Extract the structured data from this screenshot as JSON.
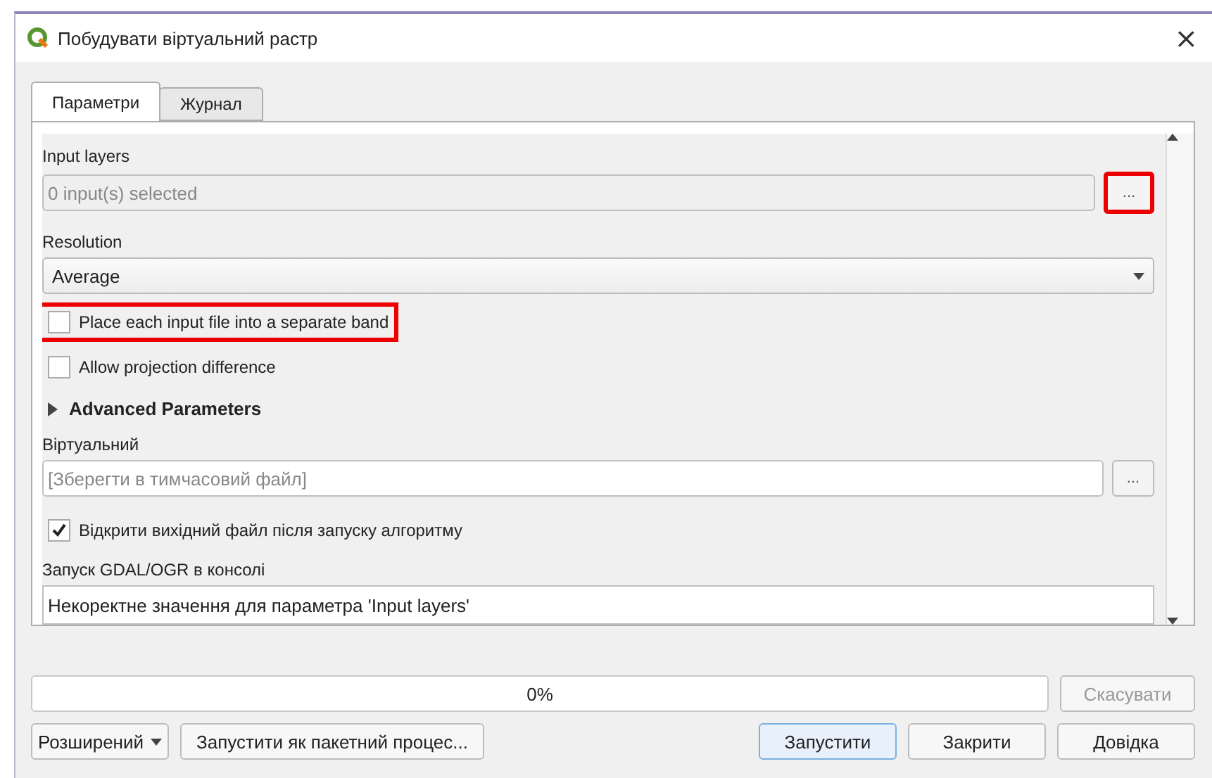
{
  "window": {
    "title": "Побудувати віртуальний растр",
    "close": "×"
  },
  "tabs": [
    {
      "label": "Параметри",
      "selected": true
    },
    {
      "label": "Журнал",
      "selected": false
    }
  ],
  "parameters": [
    {
      "kind": "label",
      "text": "Input layers"
    },
    {
      "kind": "multi",
      "placeholder": "0 input(s) selected",
      "button": "...",
      "highlighted": true
    },
    {
      "kind": "label",
      "text": "Resolution"
    },
    {
      "kind": "combo",
      "value": "Average"
    },
    {
      "kind": "checkbox",
      "text": "Place each input file into a separate band",
      "checked": false,
      "highlighted": true
    },
    {
      "kind": "checkbox",
      "text": "Allow projection difference",
      "checked": false,
      "highlighted": false
    },
    {
      "kind": "group",
      "text": "Advanced Parameters",
      "expanded": false
    },
    {
      "kind": "label",
      "text": "Віртуальний"
    },
    {
      "kind": "file",
      "placeholder": "[Зберегти в тимчасовий файл]",
      "button": "..."
    },
    {
      "kind": "checkbox",
      "text": "Відкрити вихідний файл після запуску алгоритму",
      "checked": true,
      "highlighted": false
    },
    {
      "kind": "label",
      "text": "Запуск GDAL/OGR в консолі"
    },
    {
      "kind": "console",
      "value": "Некоректне значення для параметра 'Input layers'"
    }
  ],
  "progress": {
    "reading": "0%",
    "level": 0
  },
  "cancel_button": {
    "label": "Скасувати",
    "disabled": true
  },
  "footer": {
    "advanced": "Розширений",
    "batch": "Запустити як пакетний процес...",
    "buttons": [
      {
        "label": "Запустити",
        "selected": true
      },
      {
        "label": "Закрити",
        "selected": false
      },
      {
        "label": "Довідка",
        "selected": false
      }
    ]
  }
}
